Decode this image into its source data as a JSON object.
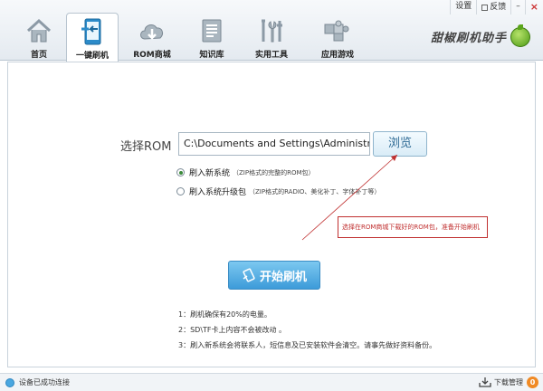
{
  "window": {
    "controls": {
      "settings": "设置",
      "feedback": "反馈",
      "minimize": "–",
      "close": "×"
    }
  },
  "tabs": [
    {
      "label": "首页",
      "icon": "home-icon",
      "active": false
    },
    {
      "label": "一键刷机",
      "icon": "one-click-flash-icon",
      "active": true
    },
    {
      "label": "ROM商城",
      "icon": "cloud-download-icon",
      "active": false
    },
    {
      "label": "知识库",
      "icon": "document-icon",
      "active": false
    },
    {
      "label": "实用工具",
      "icon": "tools-icon",
      "active": false
    },
    {
      "label": "应用游戏",
      "icon": "puzzle-icon",
      "active": false
    }
  ],
  "brand": {
    "name": "甜椒刷机助手",
    "logo": "sweet-pepper-logo"
  },
  "main": {
    "rom_label": "选择ROM",
    "rom_path": "C:\\Documents and Settings\\Administrat",
    "browse_label": "浏览",
    "options": [
      {
        "label": "刷入新系统",
        "note": "（ZIP格式的完整的ROM包）",
        "selected": true
      },
      {
        "label": "刷入系统升级包",
        "note": "（ZIP格式的RADIO、美化补丁、字体补丁等）",
        "selected": false
      }
    ],
    "callout": "选择在ROM商城下载好的ROM包，准备开始刷机",
    "start_label": "开始刷机",
    "tips": [
      "1：刷机确保有20%的电量。",
      "2：SD\\TF卡上内容不会被改动 。",
      "3：刷入新系统会将联系人，短信息及已安装软件会清空。请事先做好资料备份。"
    ]
  },
  "status": {
    "connection": "设备已成功连接",
    "download_manager": "下载管理",
    "download_count": "0"
  },
  "colors": {
    "accent": "#3d9bd9",
    "callout_red": "#c03030",
    "badge_orange": "#f08a24"
  }
}
